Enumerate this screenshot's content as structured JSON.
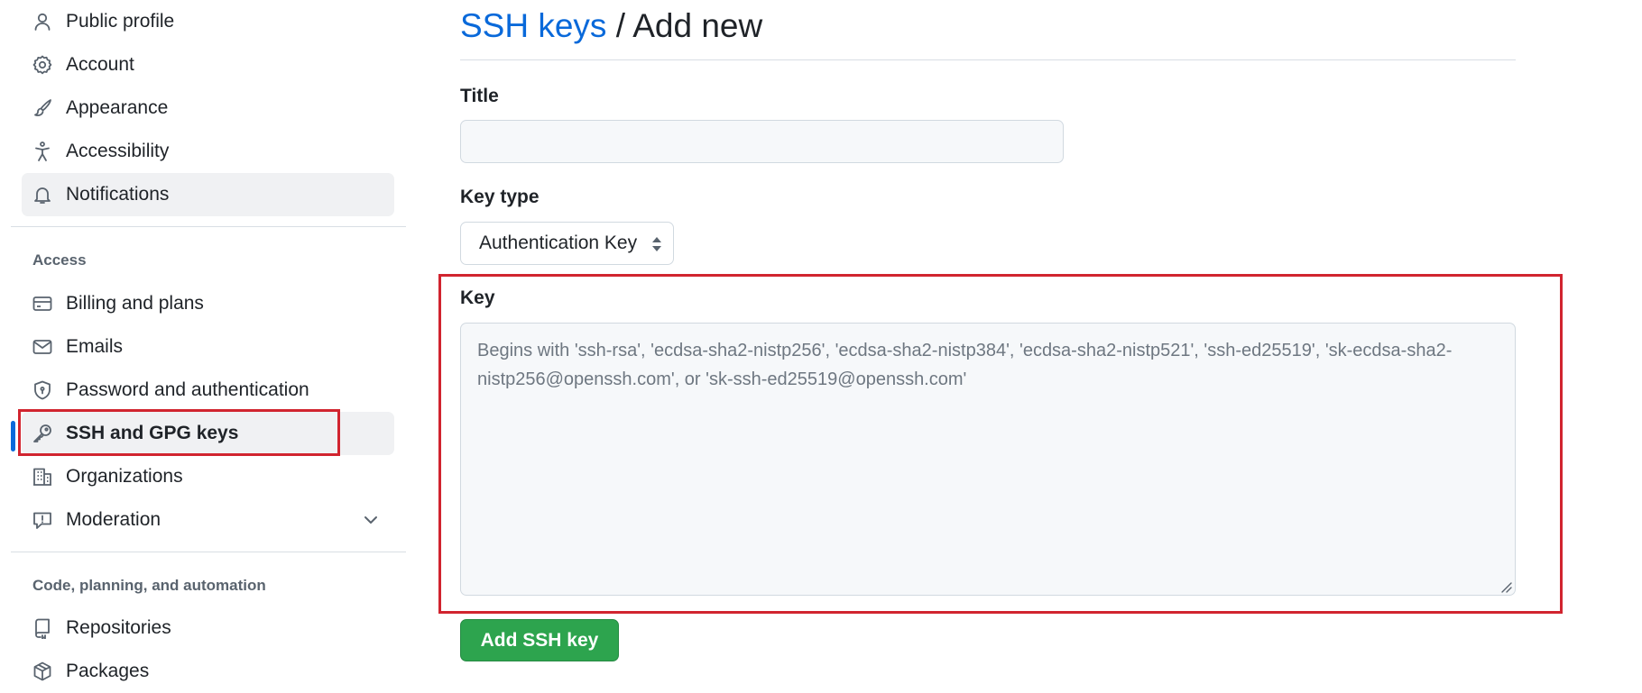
{
  "sidebar": {
    "items_top": [
      {
        "label": "Public profile",
        "icon": "person-icon"
      },
      {
        "label": "Account",
        "icon": "gear-icon"
      },
      {
        "label": "Appearance",
        "icon": "paintbrush-icon"
      },
      {
        "label": "Accessibility",
        "icon": "accessibility-icon"
      },
      {
        "label": "Notifications",
        "icon": "bell-icon"
      }
    ],
    "access_heading": "Access",
    "items_access": [
      {
        "label": "Billing and plans",
        "icon": "credit-card-icon"
      },
      {
        "label": "Emails",
        "icon": "mail-icon"
      },
      {
        "label": "Password and authentication",
        "icon": "shield-icon"
      },
      {
        "label": "SSH and GPG keys",
        "icon": "key-icon"
      },
      {
        "label": "Organizations",
        "icon": "organization-icon"
      },
      {
        "label": "Moderation",
        "icon": "report-icon"
      }
    ],
    "code_heading": "Code, planning, and automation",
    "items_code": [
      {
        "label": "Repositories",
        "icon": "repo-icon"
      },
      {
        "label": "Packages",
        "icon": "package-icon"
      }
    ]
  },
  "main": {
    "breadcrumb_link": "SSH keys",
    "breadcrumb_rest": " / Add new",
    "title_label": "Title",
    "title_value": "",
    "key_type_label": "Key type",
    "key_type_value": "Authentication Key",
    "key_label": "Key",
    "key_placeholder": "Begins with 'ssh-rsa', 'ecdsa-sha2-nistp256', 'ecdsa-sha2-nistp384', 'ecdsa-sha2-nistp521', 'ssh-ed25519', 'sk-ecdsa-sha2-nistp256@openssh.com', or 'sk-ssh-ed25519@openssh.com'",
    "submit_label": "Add SSH key"
  },
  "colors": {
    "accent": "#0969da",
    "primary_button": "#2da44e",
    "highlight_box": "#d1242f"
  }
}
